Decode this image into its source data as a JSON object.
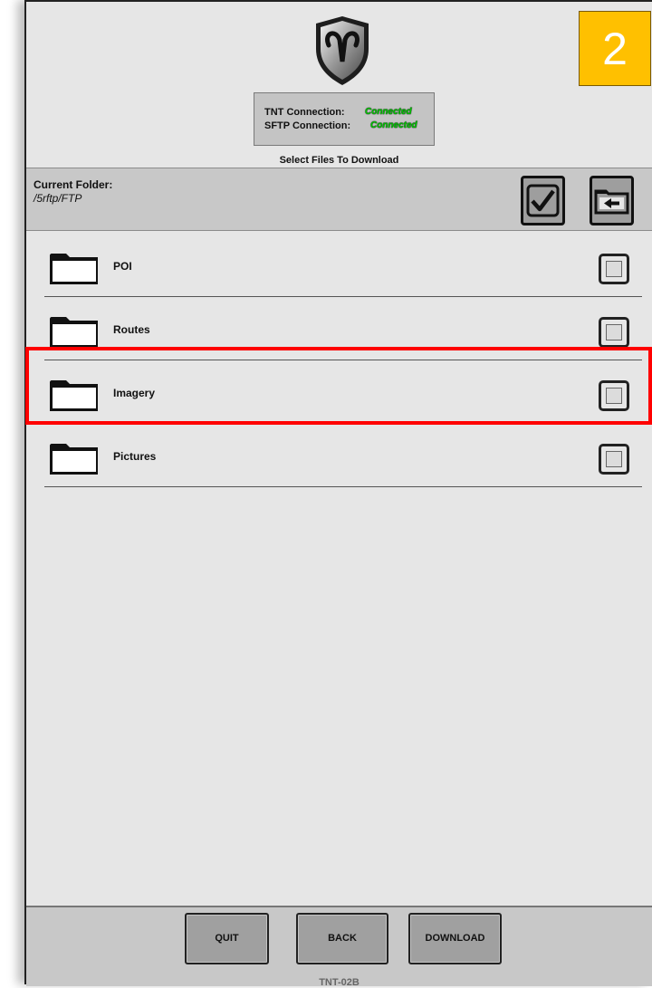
{
  "badge": {
    "number": "2"
  },
  "connection": {
    "tnt_label": "TNT Connection:",
    "tnt_status": "Connected",
    "sftp_label": "SFTP Connection:",
    "sftp_status": "Connected",
    "status_color": "#00c800"
  },
  "instruction": "Select Files To Download",
  "folder_bar": {
    "label": "Current Folder:",
    "path": "/5rftp/FTP",
    "select_all_icon": "checkbox-checked-icon",
    "parent_folder_icon": "folder-back-icon"
  },
  "files": [
    {
      "name": "POI",
      "icon": "folder-icon",
      "checked": false
    },
    {
      "name": "Routes",
      "icon": "folder-icon",
      "checked": false
    },
    {
      "name": "Imagery",
      "icon": "folder-icon",
      "checked": false,
      "highlighted": true
    },
    {
      "name": "Pictures",
      "icon": "folder-icon",
      "checked": false
    }
  ],
  "footer": {
    "quit_label": "QUIT",
    "back_label": "BACK",
    "download_label": "DOWNLOAD",
    "device_id": "TNT-02B"
  },
  "colors": {
    "highlight": "#ff0000",
    "badge": "#ffc000"
  },
  "logo_icon": "ram-shield-logo"
}
